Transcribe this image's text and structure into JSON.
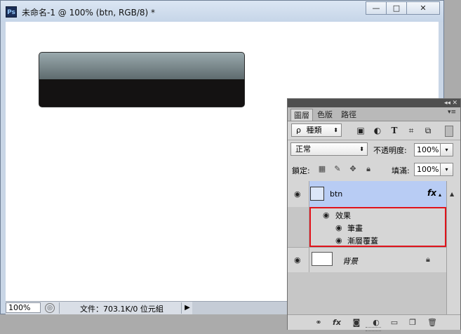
{
  "app": {
    "logo": "Ps",
    "window_title": "未命名-1 @ 100% (btn, RGB/8) *",
    "window_buttons": {
      "minimize": "—",
      "maximize": "□",
      "close": "✕"
    }
  },
  "canvas": {
    "shape_colors": {
      "top": "#9aa9ad",
      "bottom": "#141212"
    }
  },
  "status": {
    "zoom": "100%",
    "doc_info": "文件：703.1K/0 位元組",
    "arrow": "▶"
  },
  "layers_panel": {
    "collapse_icon": "◂◂",
    "close_icon": "✕",
    "tabs": [
      {
        "label": "圖層",
        "active": true
      },
      {
        "label": "色版",
        "active": false
      },
      {
        "label": "路徑",
        "active": false
      }
    ],
    "menu_icon": "▾≡",
    "filter": {
      "icon": "ρ",
      "value": "種類",
      "arrow": "⬍"
    },
    "filter_icons": [
      "image-filter-icon",
      "adjustment-filter-icon",
      "type-filter-icon",
      "shape-filter-icon",
      "smart-object-filter-icon"
    ],
    "blend_mode": {
      "value": "正常",
      "arrow": "⬍"
    },
    "opacity": {
      "label": "不透明度:",
      "value": "100%"
    },
    "lock": {
      "label": "鎖定:"
    },
    "fill": {
      "label": "填滿:",
      "value": "100%"
    },
    "layers": [
      {
        "name": "btn",
        "selected": true,
        "fx": "fx",
        "type": "shape"
      },
      {
        "name": "背景",
        "selected": false,
        "locked": true,
        "type": "background"
      }
    ],
    "effects": {
      "header": "效果",
      "items": [
        "筆畫",
        "漸層覆蓋"
      ]
    },
    "accent_selected": "#b8ccf4",
    "highlight_border": "#e0141c",
    "scroll_arrow": "▲",
    "bottom_icons": [
      "link-icon",
      "fx-icon",
      "mask-icon",
      "adjustment-icon",
      "folder-icon",
      "new-layer-icon",
      "trash-icon"
    ],
    "bottom_fx": "fx"
  }
}
